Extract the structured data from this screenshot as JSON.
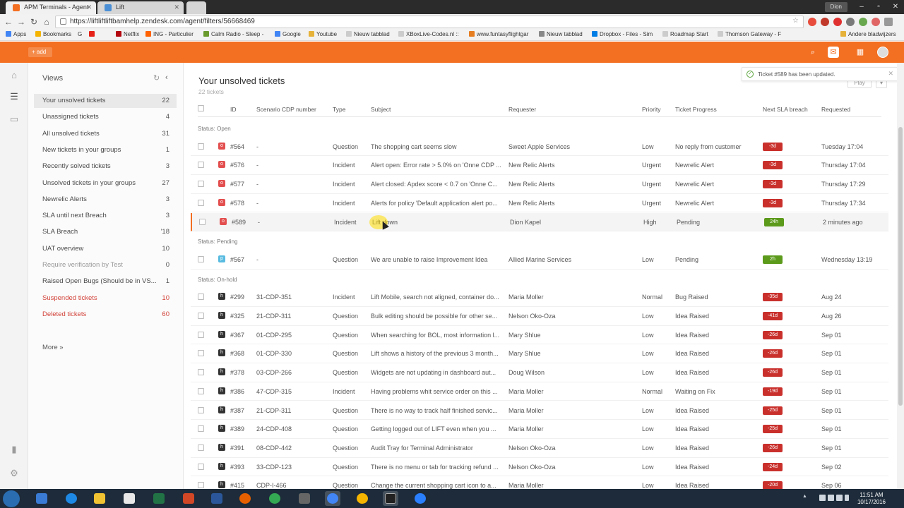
{
  "browser": {
    "tabs": [
      {
        "title": "APM Terminals - Agent"
      },
      {
        "title": "Lift"
      }
    ],
    "user": "Dion",
    "url": "https://liftliftliftbamhelp.zendesk.com/agent/filters/56668469",
    "bookmarks": [
      "Apps",
      "Bookmarks",
      "G",
      "",
      "N",
      "Netflix",
      "G",
      "ING - Particulier",
      "Calm Radio - Sleep -",
      "Google",
      "Youtube",
      "Nieuw tabblad",
      "XBoxLive-Codes.nl :: ",
      "www.funtasyflightgar",
      "Nieuw tabblad",
      "Dropbox - Files - Sim",
      "Roadmap Start",
      "Thomson Gateway - F",
      "Andere bladwijzers"
    ]
  },
  "header": {
    "add_label": "+ add"
  },
  "views": {
    "title": "Views",
    "items": [
      {
        "label": "Your unsolved tickets",
        "count": "22",
        "state": "selected"
      },
      {
        "label": "Unassigned tickets",
        "count": "4",
        "state": ""
      },
      {
        "label": "All unsolved tickets",
        "count": "31",
        "state": ""
      },
      {
        "label": "New tickets in your groups",
        "count": "1",
        "state": ""
      },
      {
        "label": "Recently solved tickets",
        "count": "3",
        "state": ""
      },
      {
        "label": "Unsolved tickets in your groups",
        "count": "27",
        "state": ""
      },
      {
        "label": "Newrelic Alerts",
        "count": "3",
        "state": ""
      },
      {
        "label": "SLA until next Breach",
        "count": "3",
        "state": ""
      },
      {
        "label": "SLA Breach",
        "count": "’18",
        "state": ""
      },
      {
        "label": "UAT overview",
        "count": "10",
        "state": ""
      },
      {
        "label": "Require verification by Test",
        "count": "0",
        "state": "muted"
      },
      {
        "label": "Raised Open Bugs (Should be in VS...",
        "count": "1",
        "state": ""
      },
      {
        "label": "Suspended tickets",
        "count": "10",
        "state": "red"
      },
      {
        "label": "Deleted tickets",
        "count": "60",
        "state": "red"
      }
    ],
    "more_label": "More »"
  },
  "main": {
    "title": "Your unsolved tickets",
    "subtitle": "22 tickets",
    "play_label": "Play",
    "play_drop": "▾",
    "columns": {
      "id": "ID",
      "scenario": "Scenario CDP number",
      "type": "Type",
      "subject": "Subject",
      "requester": "Requester",
      "priority": "Priority",
      "progress": "Ticket Progress",
      "sla": "Next SLA breach",
      "requested": "Requested"
    },
    "groups": [
      {
        "label": "Status: Open"
      },
      {
        "label": "Status: Pending"
      },
      {
        "label": "Status: On-hold"
      }
    ],
    "rows": [
      {
        "badge": "o",
        "id": "#564",
        "scenario": "-",
        "type": "Question",
        "subject": "The shopping cart seems slow",
        "requester": "Sweet Apple Services",
        "priority": "Low",
        "progress": "No reply from customer",
        "sla": "-3d",
        "requested": "Tuesday 17:04"
      },
      {
        "badge": "o",
        "id": "#576",
        "scenario": "-",
        "type": "Incident",
        "subject": "Alert open: Error rate > 5.0% on 'Onne CDP ...",
        "requester": "New Relic Alerts",
        "priority": "Urgent",
        "progress": "Newrelic Alert",
        "sla": "-3d",
        "requested": "Thursday 17:04"
      },
      {
        "badge": "o",
        "id": "#577",
        "scenario": "-",
        "type": "Incident",
        "subject": "Alert closed: Apdex score < 0.7 on 'Onne C...",
        "requester": "New Relic Alerts",
        "priority": "Urgent",
        "progress": "Newrelic Alert",
        "sla": "-3d",
        "requested": "Thursday 17:29"
      },
      {
        "badge": "o",
        "id": "#578",
        "scenario": "-",
        "type": "Incident",
        "subject": "Alerts for policy 'Default application alert po...",
        "requester": "New Relic Alerts",
        "priority": "Urgent",
        "progress": "Newrelic Alert",
        "sla": "-3d",
        "requested": "Thursday 17:34"
      },
      {
        "badge": "o",
        "id": "#589",
        "scenario": "-",
        "type": "Incident",
        "subject": "Lift down",
        "requester": "Dion Kapel",
        "priority": "High",
        "progress": "Pending",
        "sla": "24h",
        "requested": "2 minutes ago"
      },
      {
        "badge": "p",
        "id": "#567",
        "scenario": "-",
        "type": "Question",
        "subject": "We are unable to raise Improvement Idea",
        "requester": "Allied Marine Services",
        "priority": "Low",
        "progress": "Pending",
        "sla": "2h",
        "requested": "Wednesday 13:19"
      },
      {
        "badge": "h",
        "id": "#299",
        "scenario": "31-CDP-351",
        "type": "Incident",
        "subject": "Lift Mobile, search not aligned, container do...",
        "requester": "Maria Moller",
        "priority": "Normal",
        "progress": "Bug Raised",
        "sla": "-35d",
        "requested": "Aug 24"
      },
      {
        "badge": "h",
        "id": "#325",
        "scenario": "21-CDP-311",
        "type": "Question",
        "subject": "Bulk editing should be possible for other se...",
        "requester": "Nelson Oko-Oza",
        "priority": "Low",
        "progress": "Idea Raised",
        "sla": "-41d",
        "requested": "Aug 26"
      },
      {
        "badge": "h",
        "id": "#367",
        "scenario": "01-CDP-295",
        "type": "Question",
        "subject": "When searching for BOL, most information l...",
        "requester": "Mary Shlue",
        "priority": "Low",
        "progress": "Idea Raised",
        "sla": "-26d",
        "requested": "Sep 01"
      },
      {
        "badge": "h",
        "id": "#368",
        "scenario": "01-CDP-330",
        "type": "Question",
        "subject": "Lift shows a history of the previous 3 month...",
        "requester": "Mary Shlue",
        "priority": "Low",
        "progress": "Idea Raised",
        "sla": "-26d",
        "requested": "Sep 01"
      },
      {
        "badge": "h",
        "id": "#378",
        "scenario": "03-CDP-266",
        "type": "Question",
        "subject": "Widgets are not updating in dashboard aut...",
        "requester": "Doug Wilson",
        "priority": "Low",
        "progress": "Idea Raised",
        "sla": "-26d",
        "requested": "Sep 01"
      },
      {
        "badge": "h",
        "id": "#386",
        "scenario": "47-CDP-315",
        "type": "Incident",
        "subject": "Having problems whit service order on this ...",
        "requester": "Maria Moller",
        "priority": "Normal",
        "progress": "Waiting on Fix",
        "sla": "-19d",
        "requested": "Sep 01"
      },
      {
        "badge": "h",
        "id": "#387",
        "scenario": "21-CDP-311",
        "type": "Question",
        "subject": "There is no way to track half finished servic...",
        "requester": "Maria Moller",
        "priority": "Low",
        "progress": "Idea Raised",
        "sla": "-25d",
        "requested": "Sep 01"
      },
      {
        "badge": "h",
        "id": "#389",
        "scenario": "24-CDP-408",
        "type": "Question",
        "subject": "Getting logged out of LIFT even when you ...",
        "requester": "Maria Moller",
        "priority": "Low",
        "progress": "Idea Raised",
        "sla": "-25d",
        "requested": "Sep 01"
      },
      {
        "badge": "h",
        "id": "#391",
        "scenario": "08-CDP-442",
        "type": "Question",
        "subject": "Audit Tray for Terminal Administrator",
        "requester": "Nelson Oko-Oza",
        "priority": "Low",
        "progress": "Idea Raised",
        "sla": "-26d",
        "requested": "Sep 01"
      },
      {
        "badge": "h",
        "id": "#393",
        "scenario": "33-CDP-123",
        "type": "Question",
        "subject": "There is no menu or tab for tracking refund ...",
        "requester": "Nelson Oko-Oza",
        "priority": "Low",
        "progress": "Idea Raised",
        "sla": "-24d",
        "requested": "Sep 02"
      },
      {
        "badge": "h",
        "id": "#415",
        "scenario": "CDP-I-466",
        "type": "Question",
        "subject": "Change the current shopping cart icon to a...",
        "requester": "Maria Moller",
        "priority": "Low",
        "progress": "Idea Raised",
        "sla": "-20d",
        "requested": "Sep 06"
      }
    ]
  },
  "toast": {
    "message": "Ticket #589 has been updated.",
    "link": "#589"
  },
  "taskbar": {
    "time": "11:51 AM",
    "date": "10/17/2016"
  },
  "colors": {
    "brand": "#f36f21",
    "sla_red": "#c9302c",
    "sla_green": "#5c9a1b",
    "badge_open": "#e34f4f",
    "badge_pending": "#59bbe0",
    "badge_hold": "#333333"
  }
}
